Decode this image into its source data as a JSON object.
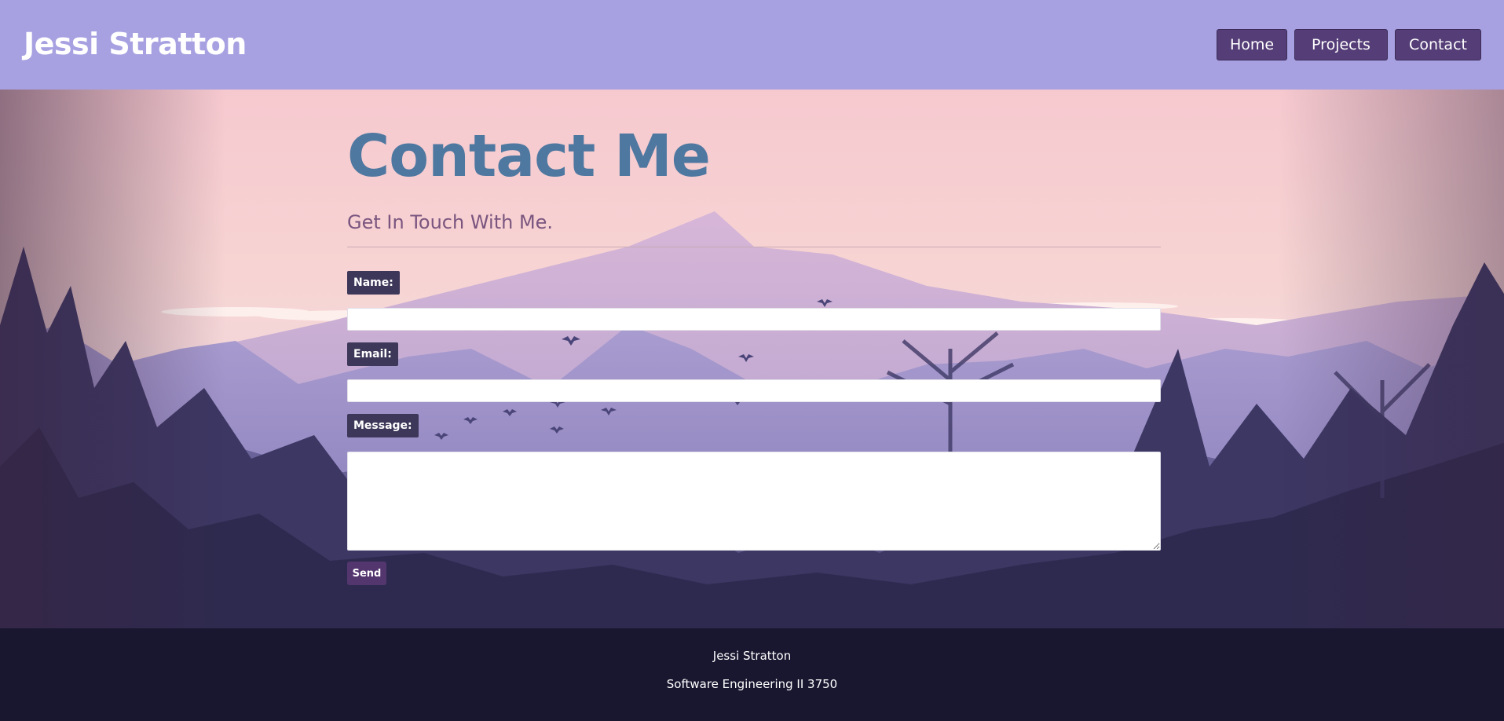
{
  "header": {
    "brand": "Jessi Stratton",
    "nav": [
      {
        "label": "Home"
      },
      {
        "label": "Projects"
      },
      {
        "label": "Contact"
      }
    ]
  },
  "main": {
    "title": "Contact Me",
    "subtitle": "Get In Touch With Me.",
    "form": {
      "name_label": "Name:",
      "name_value": "",
      "email_label": "Email:",
      "email_value": "",
      "message_label": "Message:",
      "message_value": "",
      "send_label": "Send"
    }
  },
  "footer": {
    "name": "Jessi Stratton",
    "course": "Software Engineering II 3750"
  },
  "colors": {
    "header_bg": "#a7a1e1",
    "nav_button": "#553e77",
    "title": "#4f78a1",
    "subtitle": "#7a557f",
    "label_bg": "#3d3759",
    "send_button": "#54366f",
    "footer_bg": "#191730"
  }
}
